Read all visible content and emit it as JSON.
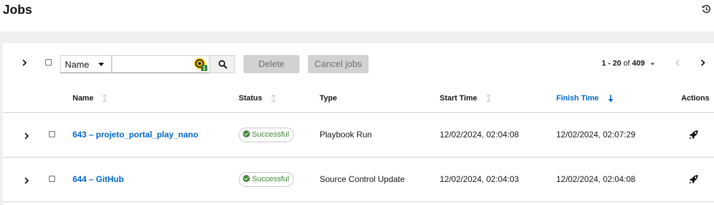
{
  "page": {
    "title": "Jobs"
  },
  "toolbar": {
    "filter_field": "Name",
    "search_value": "",
    "extension_badge_count": "1",
    "delete_label": "Delete",
    "cancel_label": "Cancel jobs"
  },
  "pagination": {
    "range": "1 - 20",
    "of_label": "of",
    "total": "409"
  },
  "table": {
    "columns": {
      "name": "Name",
      "status": "Status",
      "type": "Type",
      "start_time": "Start Time",
      "finish_time": "Finish Time",
      "actions": "Actions"
    },
    "sorted_column": "Finish Time",
    "sort_direction": "descending",
    "rows": [
      {
        "name": "643 – projeto_portal_play_nano",
        "status": "Successful",
        "type": "Playbook Run",
        "start_time": "12/02/2024, 02:04:08",
        "finish_time": "12/02/2024, 02:07:29",
        "action_icon": "rocket-icon"
      },
      {
        "name": "644 – GitHub",
        "status": "Successful",
        "type": "Source Control Update",
        "start_time": "12/02/2024, 02:04:03",
        "finish_time": "12/02/2024, 02:04:08",
        "action_icon": "rocket-icon"
      }
    ]
  },
  "icons": {
    "header": "history-icon",
    "search": "search-icon",
    "filter": "caret-down-icon"
  },
  "colors": {
    "link": "#0066cc",
    "success": "#3e8635",
    "disabled_button": "#d2d2d2",
    "page_background": "#f0f0f0"
  }
}
